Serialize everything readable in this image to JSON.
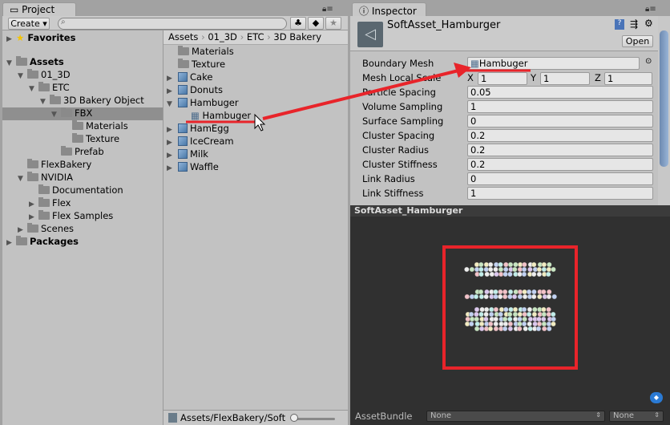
{
  "project": {
    "tab": "Project",
    "create": "Create",
    "search_placeholder": "",
    "tree": [
      {
        "label": "Favorites",
        "bold": true
      },
      {
        "label": "Assets",
        "bold": true
      },
      {
        "label": "01_3D"
      },
      {
        "label": "ETC"
      },
      {
        "label": "3D Bakery Object"
      },
      {
        "label": "FBX",
        "selected": true
      },
      {
        "label": "Materials"
      },
      {
        "label": "Texture"
      },
      {
        "label": "Prefab"
      },
      {
        "label": "FlexBakery"
      },
      {
        "label": "NVIDIA"
      },
      {
        "label": "Documentation"
      },
      {
        "label": "Flex"
      },
      {
        "label": "Flex Samples"
      },
      {
        "label": "Scenes"
      },
      {
        "label": "Packages",
        "bold": true
      }
    ],
    "breadcrumb": [
      "Assets",
      "01_3D",
      "ETC",
      "3D Bakery"
    ],
    "files": [
      {
        "label": "Materials"
      },
      {
        "label": "Texture"
      },
      {
        "label": "Cake"
      },
      {
        "label": "Donuts"
      },
      {
        "label": "Hambuger"
      },
      {
        "label": "Hambuger"
      },
      {
        "label": "HamEgg"
      },
      {
        "label": "IceCream"
      },
      {
        "label": "Milk"
      },
      {
        "label": "Waffle"
      }
    ],
    "status_path": "Assets/FlexBakery/Soft"
  },
  "inspector": {
    "tab": "Inspector",
    "title": "SoftAsset_Hamburger",
    "open": "Open",
    "props": [
      {
        "label": "Boundary Mesh",
        "value": "Hambuger"
      },
      {
        "label": "Mesh Local Scale",
        "x": "1",
        "y": "1",
        "z": "1"
      },
      {
        "label": "Particle Spacing",
        "value": "0.05"
      },
      {
        "label": "Volume Sampling",
        "value": "1"
      },
      {
        "label": "Surface Sampling",
        "value": "0"
      },
      {
        "label": "Cluster Spacing",
        "value": "0.2"
      },
      {
        "label": "Cluster Radius",
        "value": "0.2"
      },
      {
        "label": "Cluster Stiffness",
        "value": "0.2"
      },
      {
        "label": "Link Radius",
        "value": "0"
      },
      {
        "label": "Link Stiffness",
        "value": "1"
      }
    ],
    "axis": {
      "x": "X",
      "y": "Y",
      "z": "Z"
    },
    "preview_title": "SoftAsset_Hamburger",
    "assetbundle_label": "AssetBundle",
    "bundle": "None",
    "variant": "None"
  },
  "colors": {
    "annotation": "#e8242a",
    "selection": "#8f8f8f"
  }
}
